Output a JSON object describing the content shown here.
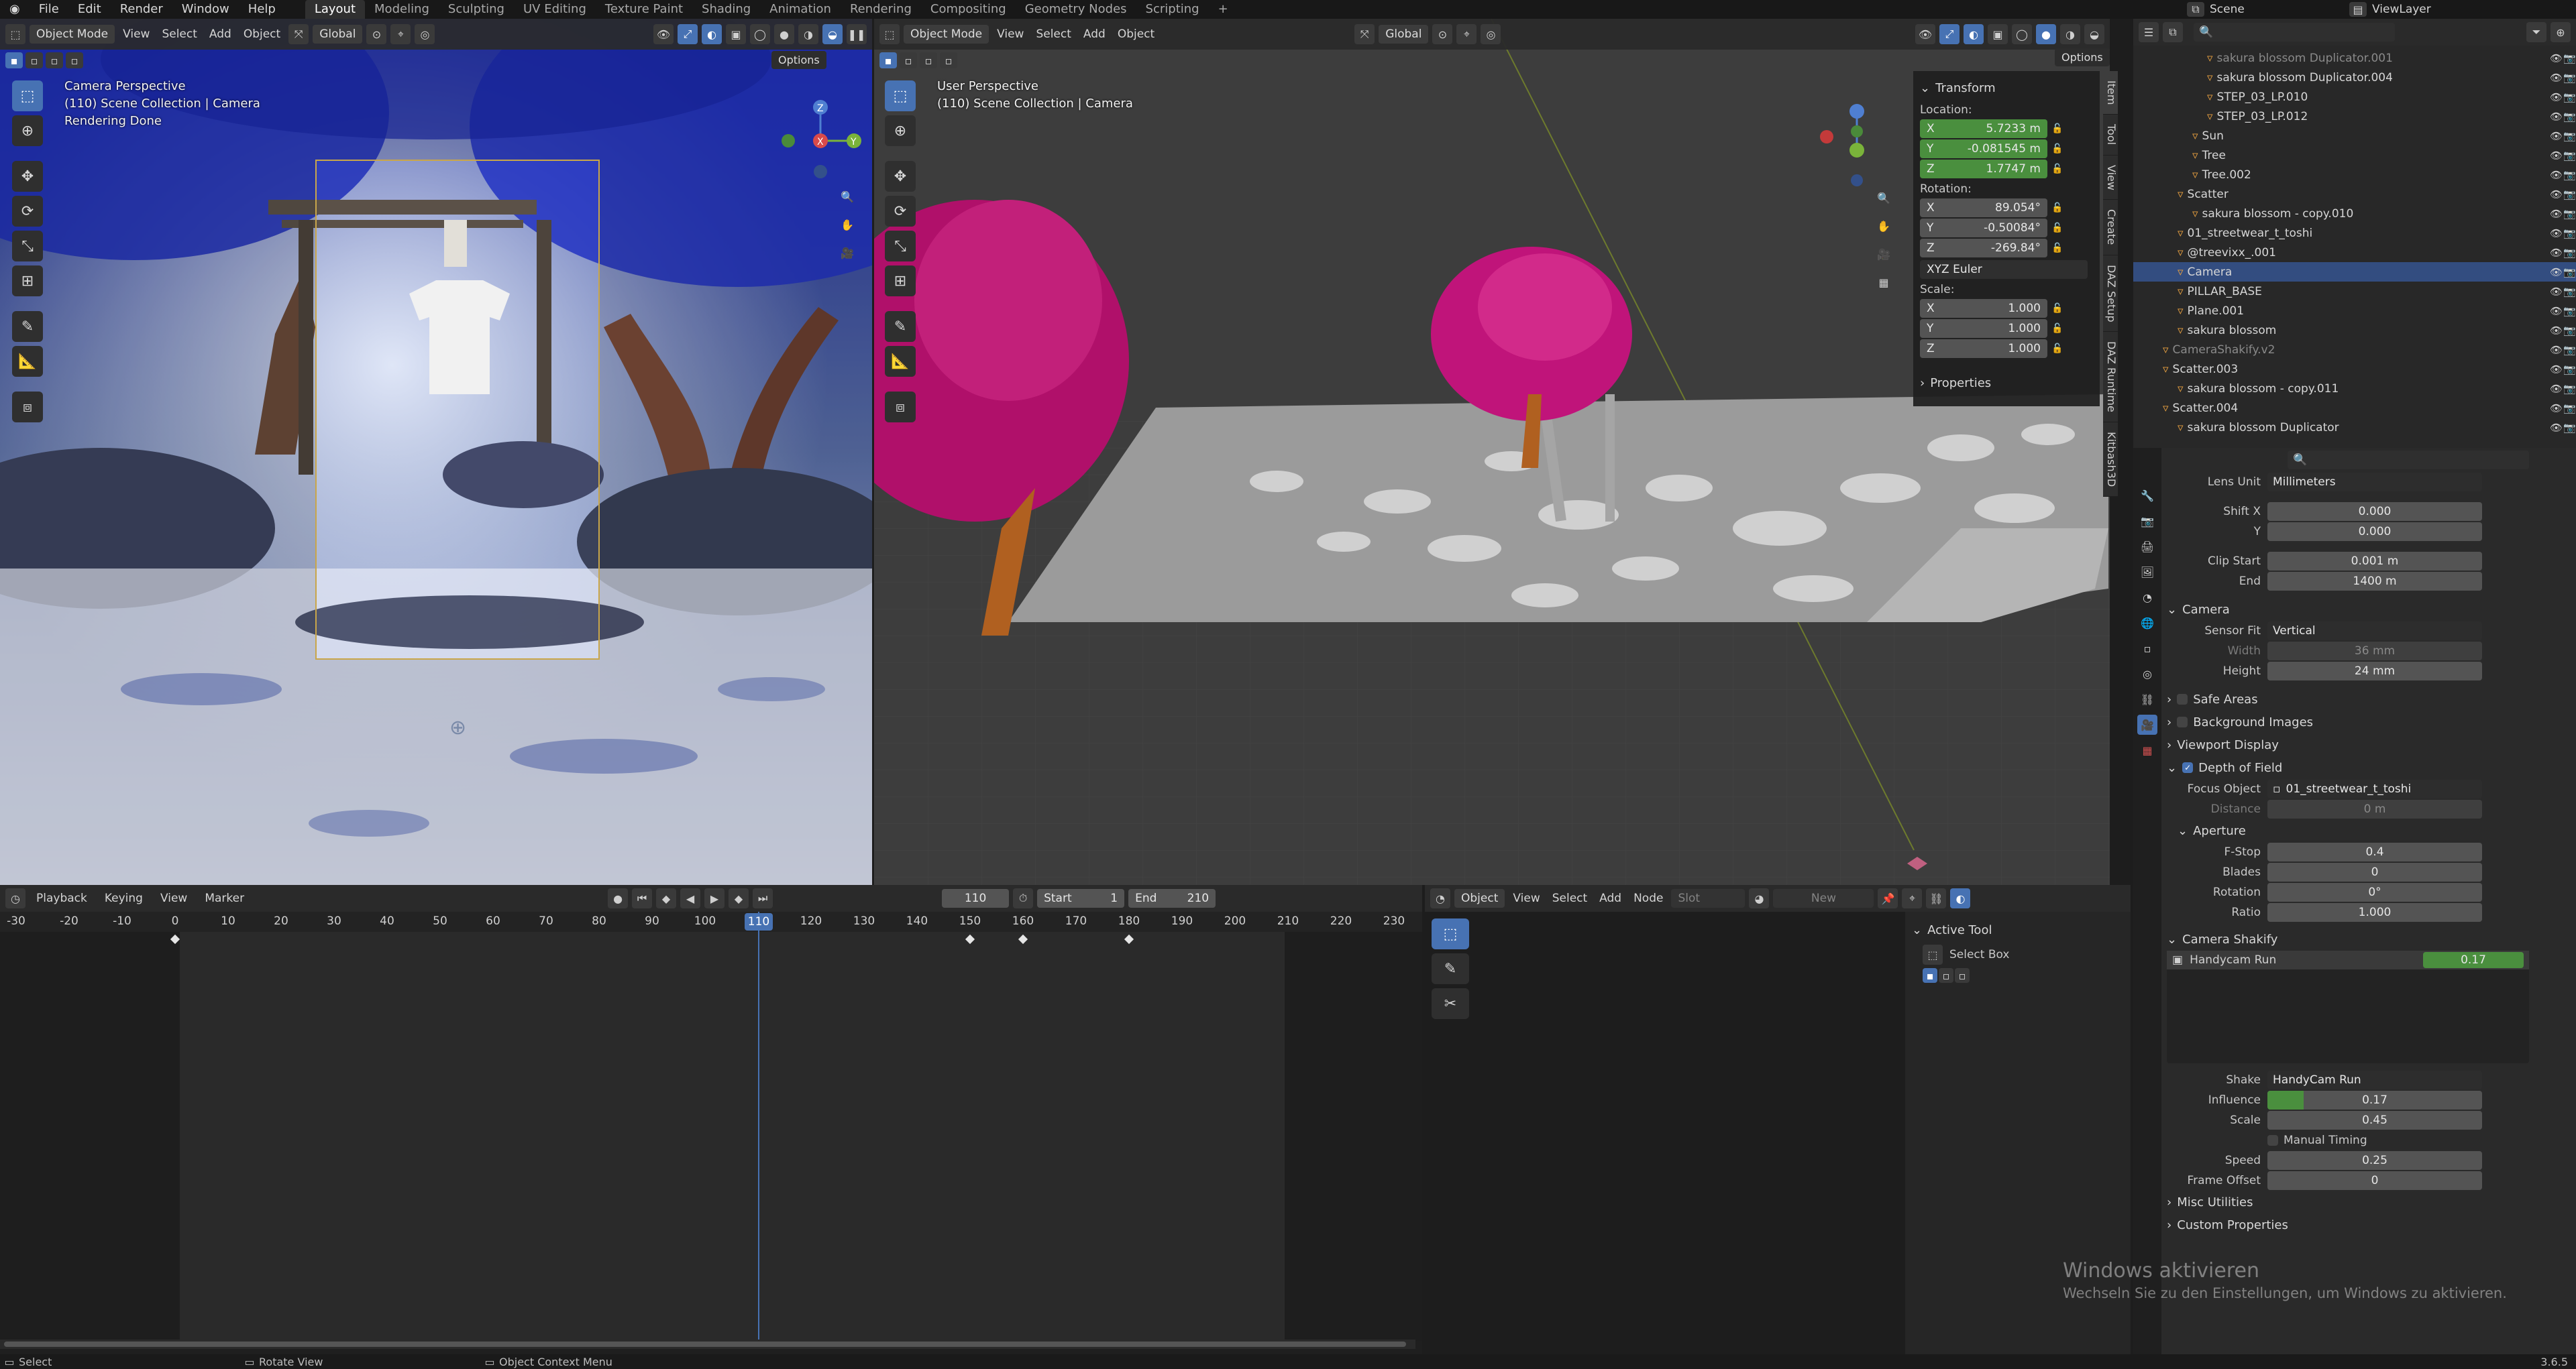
{
  "menubar": {
    "items": [
      "File",
      "Edit",
      "Render",
      "Window",
      "Help"
    ],
    "workspaces": [
      "Layout",
      "Modeling",
      "Sculpting",
      "UV Editing",
      "Texture Paint",
      "Shading",
      "Animation",
      "Rendering",
      "Compositing",
      "Geometry Nodes",
      "Scripting"
    ],
    "add_tab": "+",
    "scene": "Scene",
    "view_layer": "ViewLayer"
  },
  "viewport_left": {
    "mode": "Object Mode",
    "menus": [
      "View",
      "Select",
      "Add",
      "Object"
    ],
    "orientation": "Global",
    "options": "Options",
    "overlay": [
      "Camera Perspective",
      "(110) Scene Collection | Camera",
      "Rendering Done"
    ],
    "gizmo": {
      "x": "X",
      "y": "Y",
      "z": "Z"
    }
  },
  "viewport_right": {
    "mode": "Object Mode",
    "menus": [
      "View",
      "Select",
      "Add",
      "Object"
    ],
    "orientation": "Global",
    "options": "Options",
    "overlay": [
      "User Perspective",
      "(110) Scene Collection | Camera"
    ]
  },
  "transform_panel": {
    "title": "Transform",
    "location_label": "Location:",
    "location": [
      {
        "axis": "X",
        "value": "5.7233 m"
      },
      {
        "axis": "Y",
        "value": "-0.081545 m"
      },
      {
        "axis": "Z",
        "value": "1.7747 m"
      }
    ],
    "rotation_label": "Rotation:",
    "rotation": [
      {
        "axis": "X",
        "value": "89.054°"
      },
      {
        "axis": "Y",
        "value": "-0.50084°"
      },
      {
        "axis": "Z",
        "value": "-269.84°"
      }
    ],
    "rotation_mode": "XYZ Euler",
    "scale_label": "Scale:",
    "scale": [
      {
        "axis": "X",
        "value": "1.000"
      },
      {
        "axis": "Y",
        "value": "1.000"
      },
      {
        "axis": "Z",
        "value": "1.000"
      }
    ],
    "properties": "Properties"
  },
  "side_tabs": [
    "Item",
    "Tool",
    "View",
    "Create",
    "DAZ Setup",
    "DAZ Runtime",
    "Kitbash3D"
  ],
  "outliner": {
    "rows": [
      {
        "name": "sakura blossom Duplicator.001",
        "indent": 5,
        "dim": true
      },
      {
        "name": "sakura blossom Duplicator.004",
        "indent": 5
      },
      {
        "name": "STEP_03_LP.010",
        "indent": 5
      },
      {
        "name": "STEP_03_LP.012",
        "indent": 5
      },
      {
        "name": "Sun",
        "indent": 4
      },
      {
        "name": "Tree",
        "indent": 4
      },
      {
        "name": "Tree.002",
        "indent": 4
      },
      {
        "name": "Scatter",
        "indent": 3
      },
      {
        "name": "sakura blossom - copy.010",
        "indent": 4
      },
      {
        "name": "01_streetwear_t_toshi",
        "indent": 3
      },
      {
        "name": "@treevixx_.001",
        "indent": 3
      },
      {
        "name": "Camera",
        "indent": 3,
        "selected": true
      },
      {
        "name": "PILLAR_BASE",
        "indent": 3
      },
      {
        "name": "Plane.001",
        "indent": 3
      },
      {
        "name": "sakura blossom",
        "indent": 3
      },
      {
        "name": "CameraShakify.v2",
        "indent": 2,
        "dim": true
      },
      {
        "name": "Scatter.003",
        "indent": 2
      },
      {
        "name": "sakura blossom - copy.011",
        "indent": 3
      },
      {
        "name": "Scatter.004",
        "indent": 2
      },
      {
        "name": "sakura blossom Duplicator",
        "indent": 3
      }
    ]
  },
  "properties": {
    "lens_unit_label": "Lens Unit",
    "lens_unit": "Millimeters",
    "shift_x_label": "Shift X",
    "shift_x": "0.000",
    "shift_y_label": "Y",
    "shift_y": "0.000",
    "clip_start_label": "Clip Start",
    "clip_start": "0.001 m",
    "clip_end_label": "End",
    "clip_end": "1400 m",
    "camera_section": "Camera",
    "sensor_fit_label": "Sensor Fit",
    "sensor_fit": "Vertical",
    "width_label": "Width",
    "width": "36 mm",
    "height_label": "Height",
    "height": "24 mm",
    "safe_areas": "Safe Areas",
    "background_images": "Background Images",
    "viewport_display": "Viewport Display",
    "dof": "Depth of Field",
    "focus_object_label": "Focus Object",
    "focus_object": "01_streetwear_t_toshi",
    "distance_label": "Distance",
    "distance": "0 m",
    "aperture": "Aperture",
    "fstop_label": "F-Stop",
    "fstop": "0.4",
    "blades_label": "Blades",
    "blades": "0",
    "rotation_label": "Rotation",
    "rotation": "0°",
    "ratio_label": "Ratio",
    "ratio": "1.000",
    "camera_shakify": "Camera Shakify",
    "shake_item": "Handycam Run",
    "shake_item_value": "0.17",
    "shake_label": "Shake",
    "shake": "HandyCam Run",
    "influence_label": "Influence",
    "influence": "0.17",
    "influence_fraction": 0.17,
    "scale_label": "Scale",
    "scale": "0.45",
    "manual_timing": "Manual Timing",
    "speed_label": "Speed",
    "speed": "0.25",
    "frame_offset_label": "Frame Offset",
    "frame_offset": "0",
    "misc": "Misc Utilities",
    "custom_properties": "Custom Properties"
  },
  "timeline": {
    "menus": [
      "Playback",
      "Keying",
      "View",
      "Marker"
    ],
    "current_frame": "110",
    "start_label": "Start",
    "start": "1",
    "end_label": "End",
    "end": "210",
    "ticks": [
      "-30",
      "-20",
      "-10",
      "0",
      "10",
      "20",
      "30",
      "40",
      "50",
      "60",
      "70",
      "80",
      "90",
      "100",
      "110",
      "120",
      "130",
      "140",
      "150",
      "160",
      "170",
      "180",
      "190",
      "200",
      "210",
      "220",
      "230"
    ],
    "keyframes": [
      0,
      150,
      160,
      180
    ]
  },
  "node_editor": {
    "object": "Object",
    "menus": [
      "View",
      "Select",
      "Add",
      "Node"
    ],
    "slot": "Slot",
    "new": "New",
    "active_tool": "Active Tool",
    "select_box": "Select Box"
  },
  "statusbar": {
    "select": "Select",
    "rotate": "Rotate View",
    "context": "Object Context Menu",
    "version": "3.6.5"
  },
  "watermark": {
    "title": "Windows aktivieren",
    "subtitle": "Wechseln Sie zu den Einstellungen, um Windows zu aktivieren."
  }
}
